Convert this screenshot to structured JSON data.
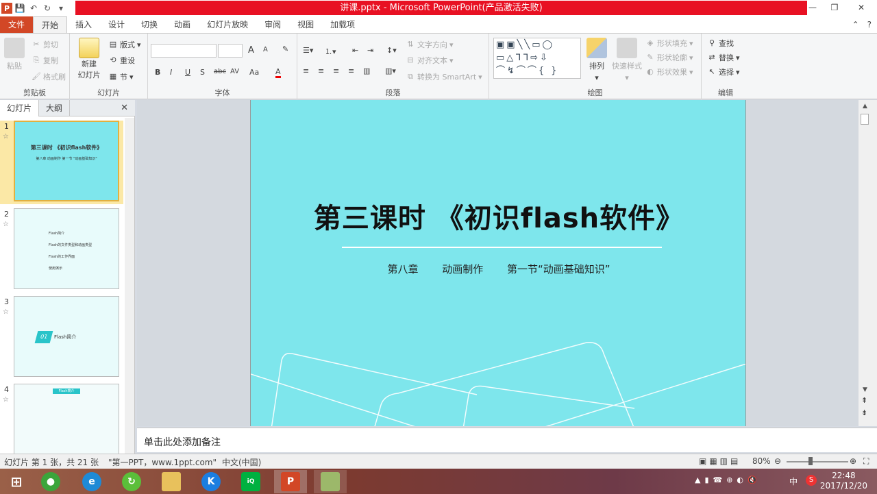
{
  "window": {
    "title": "讲课.pptx - Microsoft PowerPoint(产品激活失败)",
    "minimize": "—",
    "maximize": "❐",
    "close": "✕"
  },
  "tabs": [
    "文件",
    "开始",
    "插入",
    "设计",
    "切换",
    "动画",
    "幻灯片放映",
    "审阅",
    "视图",
    "加载项"
  ],
  "ribbon": {
    "clipboard": {
      "label": "剪贴板",
      "paste": "粘贴",
      "cut": "剪切",
      "copy": "复制",
      "format_painter": "格式刷"
    },
    "slides": {
      "label": "幻灯片",
      "new_slide_1": "新建",
      "new_slide_2": "幻灯片",
      "layout": "版式",
      "reset": "重设",
      "section": "节"
    },
    "font": {
      "label": "字体",
      "bold": "B",
      "italic": "I",
      "underline": "U",
      "strike": "S",
      "shadow": "abc",
      "spacing": "AV",
      "case": "Aa",
      "color": "A",
      "grow": "A",
      "shrink": "A"
    },
    "paragraph": {
      "label": "段落",
      "text_direction": "文字方向",
      "align_text": "对齐文本",
      "smartart": "转换为 SmartArt"
    },
    "drawing": {
      "label": "绘图",
      "arrange": "排列",
      "quick_styles": "快速样式",
      "shape_fill": "形状填充",
      "shape_outline": "形状轮廓",
      "shape_effects": "形状效果"
    },
    "editing": {
      "label": "编辑",
      "find": "查找",
      "replace": "替换",
      "select": "选择"
    }
  },
  "left_pane": {
    "tab_slides": "幻灯片",
    "tab_outline": "大纲",
    "close": "✕",
    "thumbnails": [
      {
        "num": "1",
        "title": "第三课时 《初识flash软件》",
        "sub": "第八章 动画制作    第一节 \"动画基础知识\""
      },
      {
        "num": "2",
        "items": [
          "Flash简介",
          "Flash的文件类型和动画类型",
          "Flash的工作界面",
          "使用演示"
        ]
      },
      {
        "num": "3",
        "badge": "01",
        "label": "Flash简介"
      },
      {
        "num": "4",
        "heading": "Flash简介"
      }
    ]
  },
  "slide": {
    "title": "第三课时 《初识flash软件》",
    "subtitle": "第八章 动画制作  第一节“动画基础知识”"
  },
  "notes_placeholder": "单击此处添加备注",
  "status": {
    "slide_info": "幻灯片 第 1 张，共 21 张",
    "theme": "\"第一PPT，www.1ppt.com\"",
    "language": "中文(中国)",
    "zoom": "80%"
  },
  "taskbar": {
    "time": "22:48",
    "date": "2017/12/20",
    "ime": "中"
  },
  "colors": {
    "accent": "#d24726",
    "slide_bg": "#7ee6ec",
    "title_red": "#e81123"
  }
}
